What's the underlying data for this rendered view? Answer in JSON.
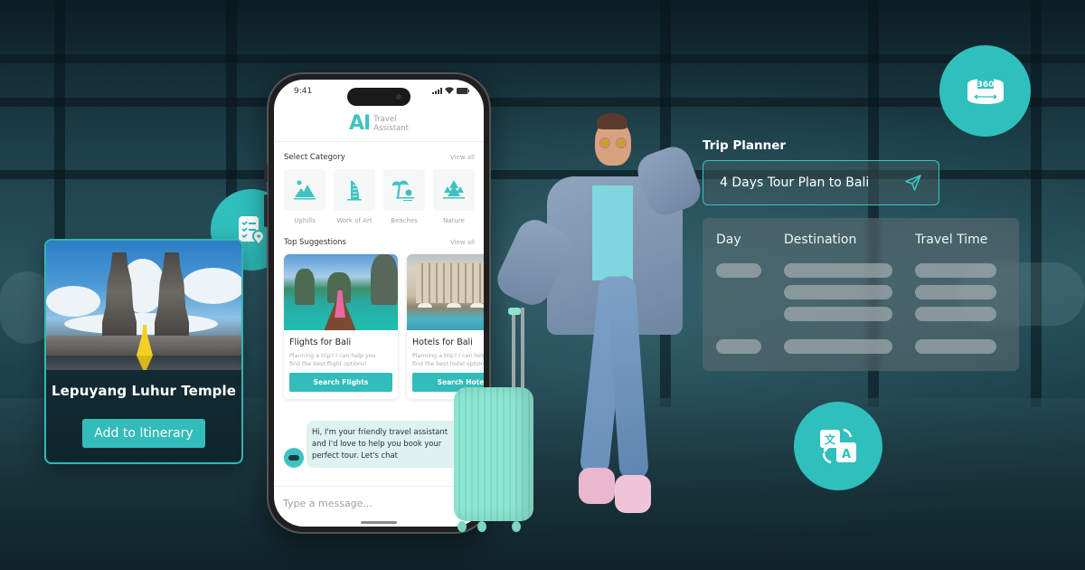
{
  "colors": {
    "accent": "#2fbfbd",
    "button": "#32bcba",
    "chat_bubble": "#dff1f1",
    "background": "#10252c"
  },
  "feature_icons": [
    {
      "name": "checklist-location-icon",
      "label": "itinerary"
    },
    {
      "name": "panorama-360-icon",
      "label": "360"
    },
    {
      "name": "translate-icon",
      "glyphs": [
        "文",
        "A"
      ]
    }
  ],
  "temple_card": {
    "title": "Lepuyang Luhur Temple",
    "button": "Add to Itinerary"
  },
  "phone": {
    "status_time": "9:41",
    "app_logo": {
      "mark": "AI",
      "line1": "Travel",
      "line2": "Assistant"
    },
    "categories": {
      "title": "Select Category",
      "view_all": "View all",
      "items": [
        {
          "label": "Uphills",
          "icon": "mountain-icon"
        },
        {
          "label": "Work of Art",
          "icon": "burj-al-arab-icon"
        },
        {
          "label": "Beaches",
          "icon": "palm-beach-icon"
        },
        {
          "label": "Nature",
          "icon": "forest-icon"
        }
      ]
    },
    "suggestions": {
      "title": "Top Suggestions",
      "view_all": "View all",
      "cards": [
        {
          "title": "Flights for Bali",
          "desc1": "Planning a trip? I can help you",
          "desc2": "find the best flight options!",
          "button": "Search Flights"
        },
        {
          "title": "Hotels for Bali",
          "desc1": "Planning a trip? I can help you",
          "desc2": "find the best hotel options!",
          "button": "Search Hotels"
        }
      ]
    },
    "chat": {
      "line1": "Hi, I'm your friendly travel assistant",
      "line2": "and I'd love to help you book your",
      "line3": "perfect tour. Let's chat"
    },
    "compose_placeholder": "Type a message..."
  },
  "trip_planner": {
    "label": "Trip Planner",
    "query": "4 Days Tour Plan to Bali",
    "columns": [
      "Day",
      "Destination",
      "Travel Time"
    ]
  }
}
